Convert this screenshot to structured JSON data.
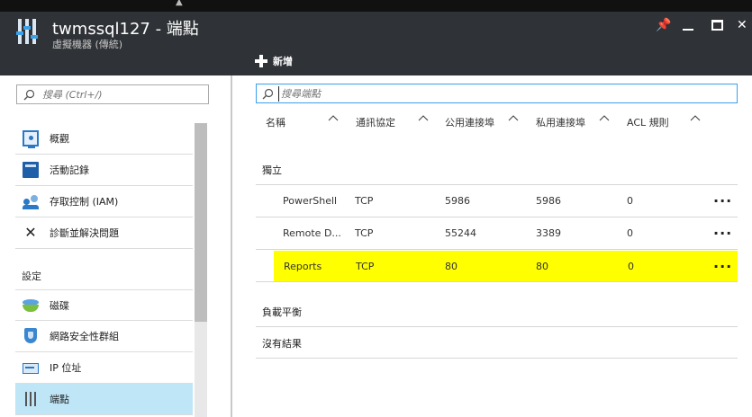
{
  "window": {
    "title": "twmssql127 - 端點",
    "subtitle": "虛擬機器 (傳統)"
  },
  "toolbar": {
    "add_label": "新增"
  },
  "left": {
    "search_placeholder": "搜尋 (Ctrl+/)",
    "items": [
      {
        "label": "概觀",
        "icon": "overview-icon"
      },
      {
        "label": "活動記錄",
        "icon": "activity-log-icon"
      },
      {
        "label": "存取控制 (IAM)",
        "icon": "users-icon"
      },
      {
        "label": "診斷並解決問題",
        "icon": "tools-icon"
      }
    ],
    "section_settings": "設定",
    "settings_items": [
      {
        "label": "磁碟",
        "icon": "disk-icon"
      },
      {
        "label": "網路安全性群組",
        "icon": "shield-icon"
      },
      {
        "label": "IP 位址",
        "icon": "ip-address-icon"
      },
      {
        "label": "端點",
        "icon": "endpoint-icon"
      }
    ]
  },
  "right": {
    "search_placeholder": "搜尋端點",
    "columns": [
      "名稱",
      "通訊協定",
      "公用連接埠",
      "私用連接埠",
      "ACL 規則"
    ],
    "group_standalone": "獨立",
    "rows": [
      {
        "name": "PowerShell",
        "protocol": "TCP",
        "public_port": "5986",
        "private_port": "5986",
        "acl": "0",
        "more": "..."
      },
      {
        "name": "Remote D...",
        "protocol": "TCP",
        "public_port": "55244",
        "private_port": "3389",
        "acl": "0",
        "more": "..."
      },
      {
        "name": "Reports",
        "protocol": "TCP",
        "public_port": "80",
        "private_port": "80",
        "acl": "0",
        "more": "...",
        "highlighted": true
      }
    ],
    "group_load_balanced": "負載平衡",
    "no_results": "沒有結果"
  },
  "colors": {
    "header_bg": "#2f3236",
    "active_nav": "#bfe6f7",
    "accent": "#3aa0ea",
    "highlight": "#ffff00"
  }
}
